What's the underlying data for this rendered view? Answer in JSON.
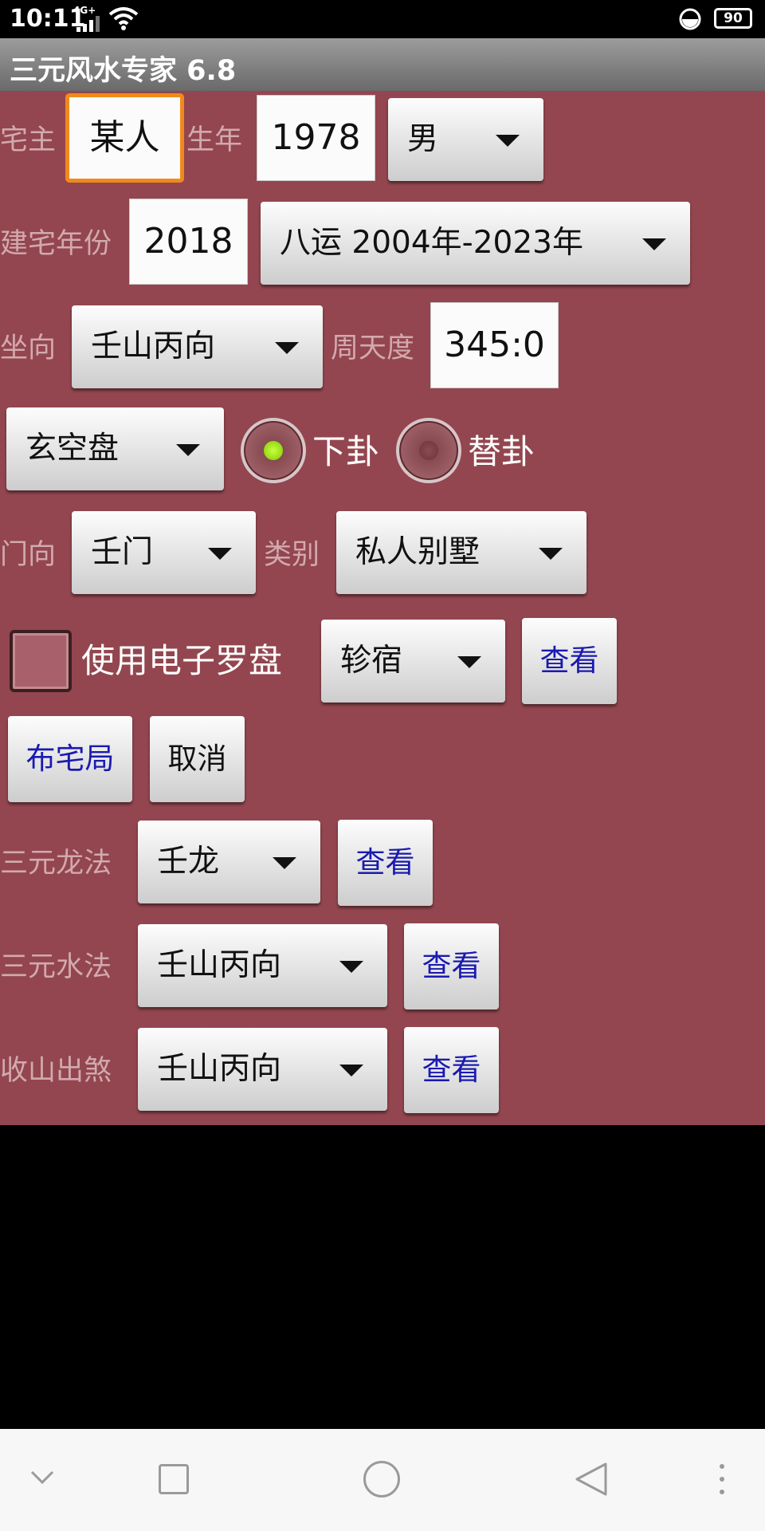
{
  "status_bar": {
    "time": "10:11",
    "network": "4G+",
    "battery": "90"
  },
  "app": {
    "title": "三元风水专家 6.8"
  },
  "row1": {
    "owner_label": "宅主",
    "owner_value": "某人",
    "birth_label": "生年",
    "birth_year": "1978",
    "gender": "男"
  },
  "row2": {
    "build_label": "建宅年份",
    "build_year": "2018",
    "period": "八运  2004年-2023年"
  },
  "row3": {
    "facing_label": "坐向",
    "facing": "壬山丙向",
    "degree_label": "周天度",
    "degree_value": "345:0"
  },
  "row4": {
    "chart_type": "玄空盘",
    "radio_xiagua": "下卦",
    "radio_tigua": "替卦",
    "selected": "下卦"
  },
  "row5": {
    "door_label": "门向",
    "door": "壬门",
    "category_label": "类别",
    "category": "私人别墅"
  },
  "row6": {
    "compass_label": "使用电子罗盘",
    "compass_checked": false,
    "mansion": "轸宿",
    "view_label": "查看"
  },
  "row7": {
    "layout_button": "布宅局",
    "cancel_button": "取消"
  },
  "dragon": {
    "label": "三元龙法",
    "value": "壬龙",
    "view_label": "查看"
  },
  "water": {
    "label": "三元水法",
    "value": "壬山丙向",
    "view_label": "查看"
  },
  "mountain": {
    "label": "收山出煞",
    "value": "壬山丙向",
    "view_label": "查看"
  },
  "colors": {
    "background": "#93464f",
    "link_blue": "#1a1ab0",
    "focus_orange": "#f08a1c",
    "radio_green": "#8ee000"
  }
}
